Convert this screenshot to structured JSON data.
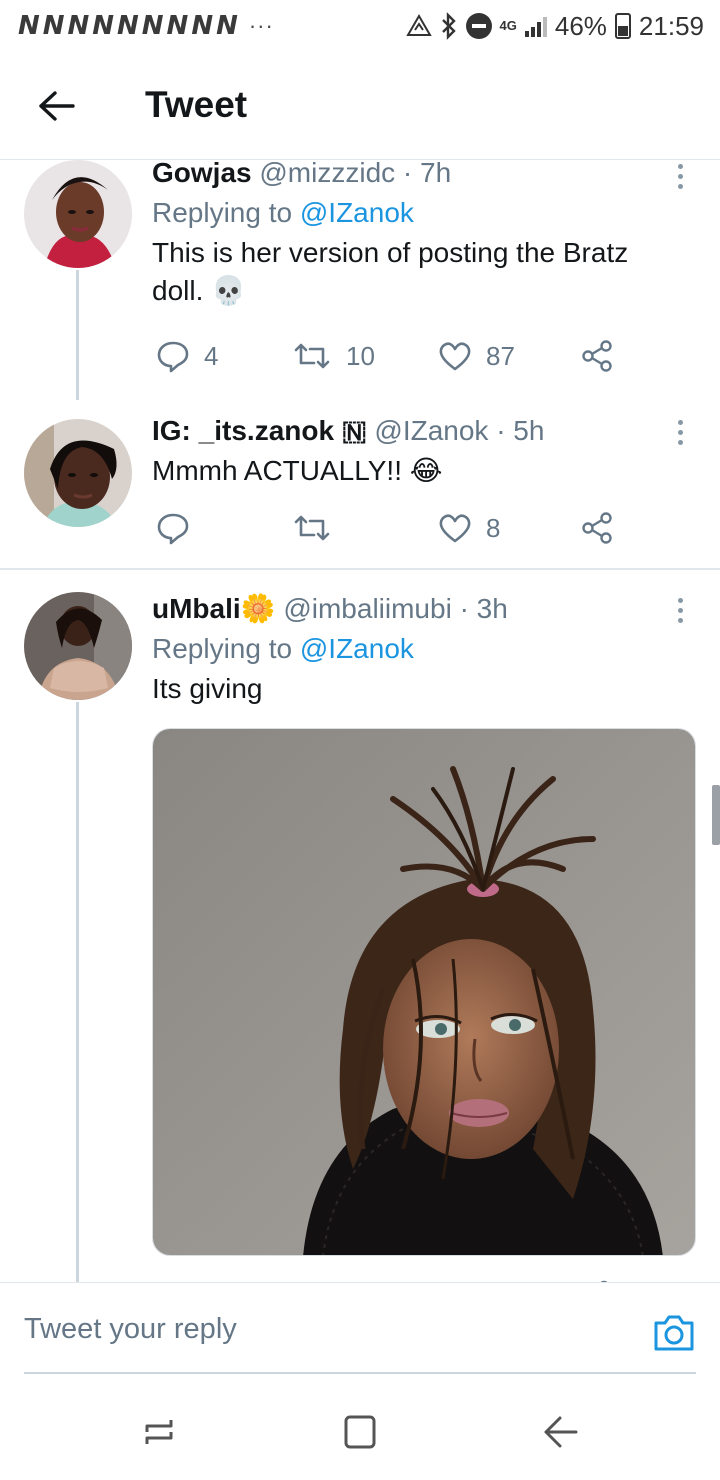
{
  "status_bar": {
    "notification_icons": "NNNNNNNNN",
    "more": "···",
    "network": "4G",
    "battery": "46%",
    "time": "21:59"
  },
  "header": {
    "title": "Tweet"
  },
  "tweets": [
    {
      "name": "Gowjas",
      "handle": "@mizzzidc",
      "time": "· 7h",
      "replying_label": "Replying to",
      "replying_to": "@IZanok",
      "text": "This is her version of posting the Bratz doll. 💀",
      "replies": "4",
      "retweets": "10",
      "likes": "87"
    },
    {
      "name": "IG: _its.zanok 🇳",
      "handle": "@IZanok",
      "time": "· 5h",
      "text": "Mmmh ACTUALLY!! 😂",
      "replies": "",
      "retweets": "",
      "likes": "8"
    },
    {
      "name": "uMbali",
      "name_emoji": "🌼",
      "handle": "@imbaliimubi",
      "time": "· 3h",
      "replying_label": "Replying to",
      "replying_to": "@IZanok",
      "text": "Its giving"
    }
  ],
  "composer": {
    "placeholder": "Tweet your reply"
  },
  "colors": {
    "accent": "#1b95e0",
    "secondary_text": "#657786",
    "primary_text": "#14171a",
    "divider": "#e1e8ed"
  },
  "icons": {
    "back": "arrow-left-icon",
    "reply": "comment-icon",
    "retweet": "retweet-icon",
    "like": "heart-icon",
    "share": "share-icon",
    "more": "more-vertical-icon",
    "camera": "camera-icon",
    "nav_recent": "recent-apps-icon",
    "nav_home": "home-icon",
    "nav_back": "nav-back-icon"
  }
}
